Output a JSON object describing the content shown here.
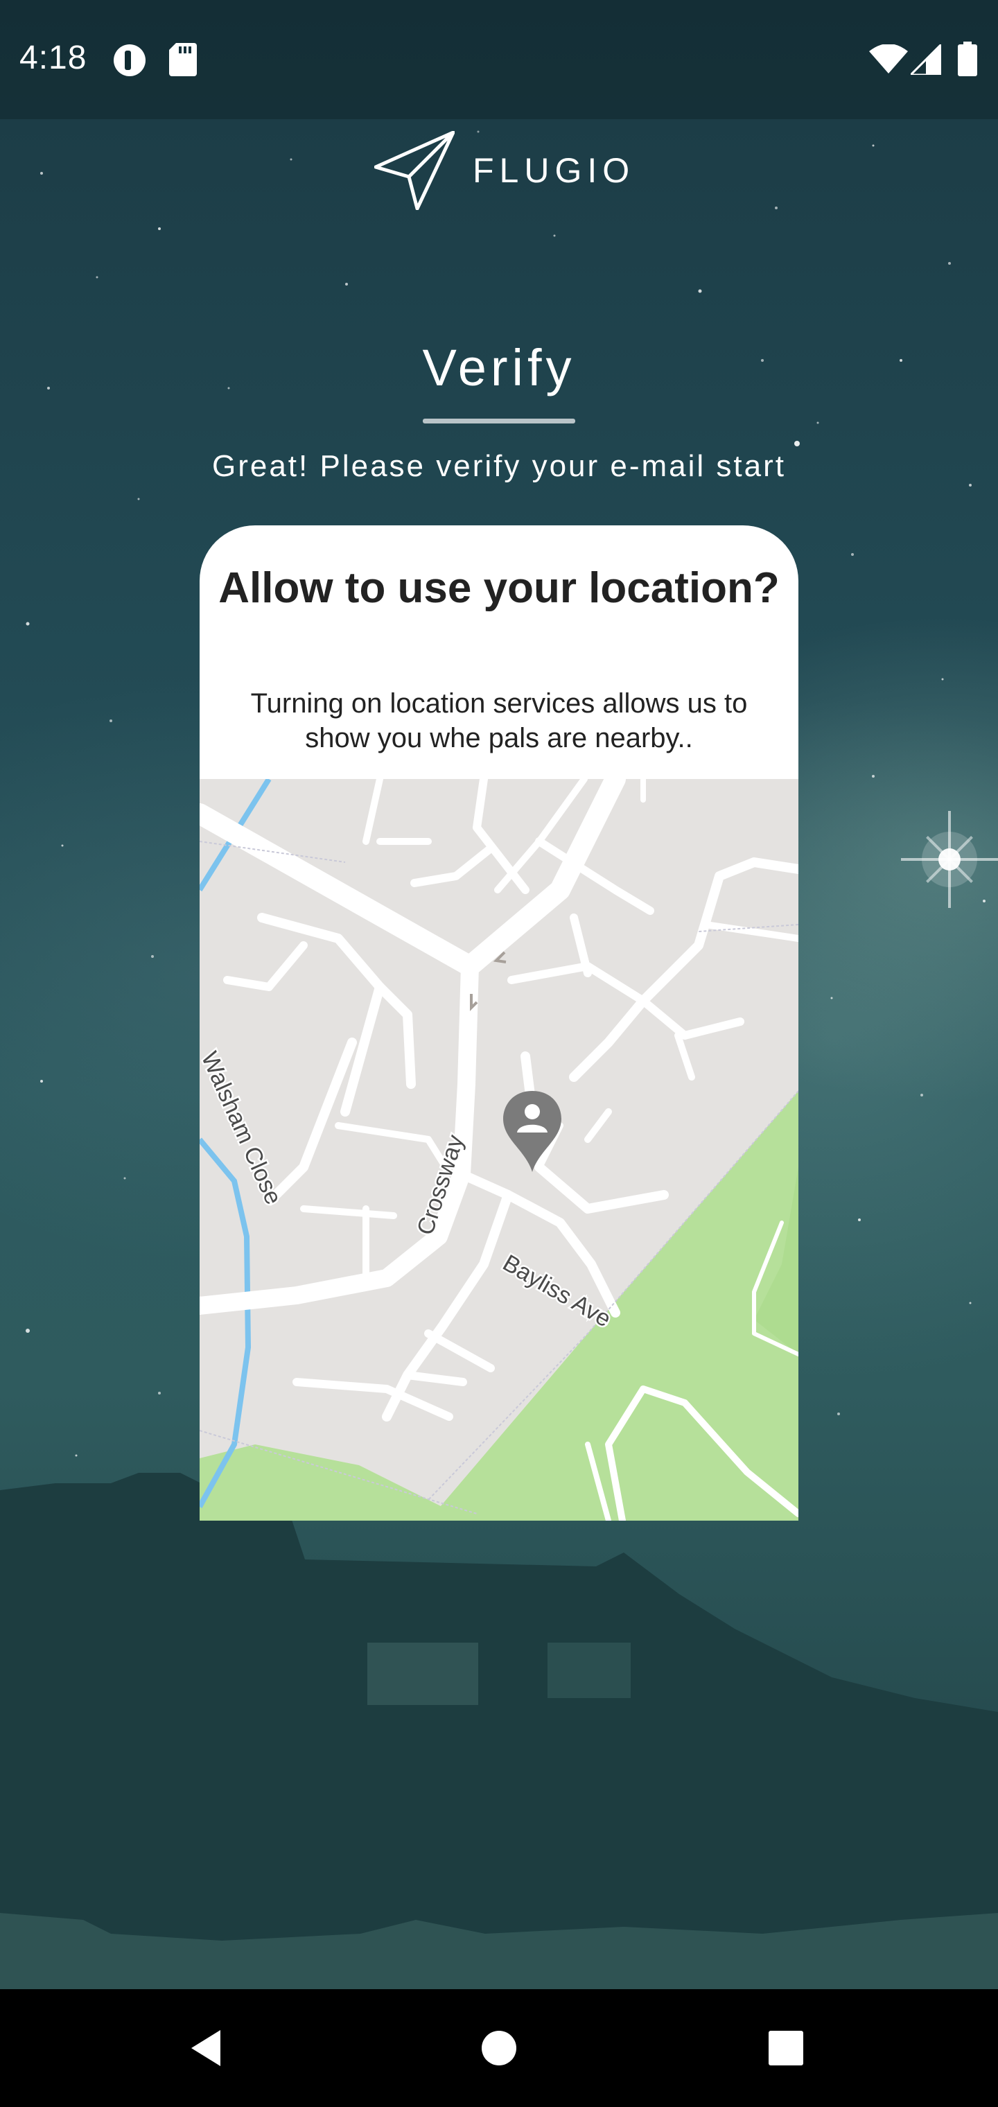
{
  "status_bar": {
    "time": "4:18",
    "icons": [
      "data-saver-icon",
      "sd-card-icon",
      "wifi-icon",
      "cell-signal-icon",
      "battery-icon"
    ]
  },
  "brand": {
    "name": "FLUGIO",
    "icon": "paper-plane-icon"
  },
  "page": {
    "title": "Verify",
    "subtitle": "Great! Please verify your e-mail start"
  },
  "dialog": {
    "title": "Allow to use your location?",
    "message": "Turning on location services allows us to show you whe pals are nearby.."
  },
  "map": {
    "streets": [
      "Walsham Close",
      "Crossway",
      "Bayliss Ave"
    ],
    "marker": "person-location-icon",
    "colors": {
      "land": "#e4e2e0",
      "park": "#b6e09a",
      "road": "#ffffff",
      "water": "#7cc3ee"
    }
  },
  "nav_bar": {
    "buttons": [
      "back-icon",
      "home-icon",
      "recents-icon"
    ]
  }
}
